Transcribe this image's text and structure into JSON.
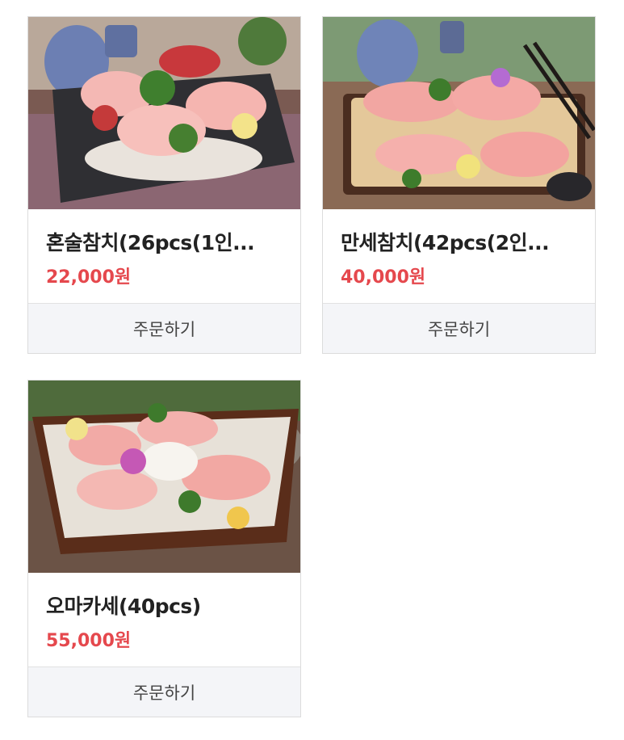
{
  "products": [
    {
      "name": "혼술참치(26pcs(1인...",
      "price": "22,000원",
      "order_label": "주문하기",
      "image": "tuna-sashimi-platter-photo"
    },
    {
      "name": "만세참치(42pcs(2인...",
      "price": "40,000원",
      "order_label": "주문하기",
      "image": "tuna-sashimi-wood-tray-photo"
    },
    {
      "name": "오마카세(40pcs)",
      "price": "55,000원",
      "order_label": "주문하기",
      "image": "omakase-boat-platter-photo"
    }
  ],
  "colors": {
    "price": "#e5484d",
    "button_bg": "#f4f5f8",
    "border": "#dcdcdc"
  }
}
